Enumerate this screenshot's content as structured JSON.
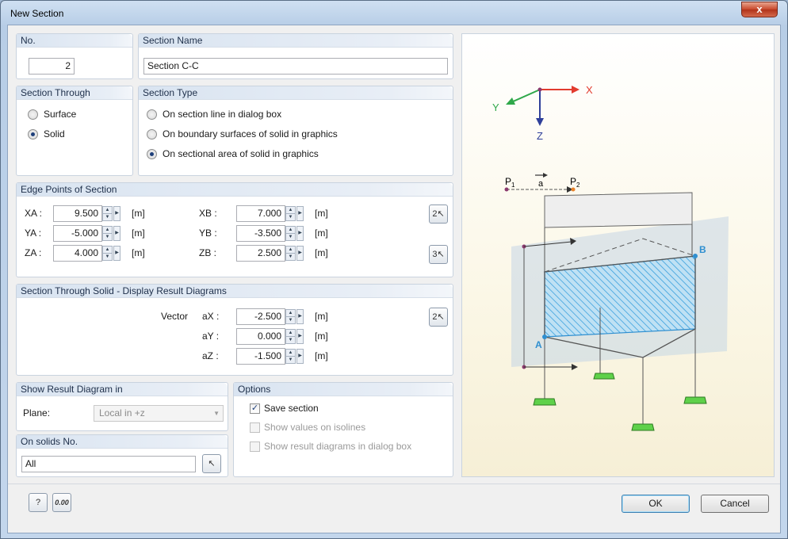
{
  "window": {
    "title": "New Section",
    "close_label": "x"
  },
  "no": {
    "header": "No.",
    "value": "2"
  },
  "section_name": {
    "header": "Section Name",
    "value": "Section C-C"
  },
  "section_through": {
    "header": "Section Through",
    "options": [
      "Surface",
      "Solid"
    ],
    "selected": "Solid"
  },
  "section_type": {
    "header": "Section Type",
    "options": [
      "On section line in dialog box",
      "On boundary surfaces of solid in graphics",
      "On sectional area of solid in graphics"
    ],
    "selected": "On sectional area of solid in graphics"
  },
  "edge_points": {
    "header": "Edge Points of Section",
    "unit": "[m]",
    "xa": {
      "label": "XA :",
      "value": "9.500"
    },
    "ya": {
      "label": "YA :",
      "value": "-5.000"
    },
    "za": {
      "label": "ZA :",
      "value": "4.000"
    },
    "xb": {
      "label": "XB :",
      "value": "7.000"
    },
    "yb": {
      "label": "YB :",
      "value": "-3.500"
    },
    "zb": {
      "label": "ZB :",
      "value": "2.500"
    },
    "pick_two_icon": "2-point-pick-icon",
    "pick_three_icon": "3-point-pick-icon"
  },
  "result_diagrams": {
    "header": "Section Through Solid - Display Result Diagrams",
    "vector_label": "Vector",
    "unit": "[m]",
    "ax": {
      "label": "aX :",
      "value": "-2.500"
    },
    "ay": {
      "label": "aY :",
      "value": "0.000"
    },
    "az": {
      "label": "aZ :",
      "value": "-1.500"
    }
  },
  "show_result": {
    "header": "Show Result Diagram in",
    "plane_label": "Plane:",
    "plane_value": "Local in +z"
  },
  "on_solids": {
    "header": "On solids No.",
    "value": "All"
  },
  "options": {
    "header": "Options",
    "save_section": {
      "label": "Save section",
      "checked": true
    },
    "show_values": {
      "label": "Show values on isolines",
      "checked": false
    },
    "show_diagrams": {
      "label": "Show result diagrams in dialog box",
      "checked": false
    }
  },
  "preview": {
    "axis_x": "X",
    "axis_y": "Y",
    "axis_z": "Z",
    "p1": "P",
    "p1_sub": "1",
    "p2": "P",
    "p2_sub": "2",
    "vec": "a",
    "point_a": "A",
    "point_b": "B",
    "colors": {
      "x": "#e23b2e",
      "y": "#2fa84a",
      "z": "#2f3f9a",
      "section": "#4aaee6",
      "support": "#5fd14a"
    }
  },
  "footer": {
    "ok_label": "OK",
    "cancel_label": "Cancel",
    "help_icon": "help-icon",
    "units_icon": "units-icon",
    "units_text": "0.00"
  }
}
